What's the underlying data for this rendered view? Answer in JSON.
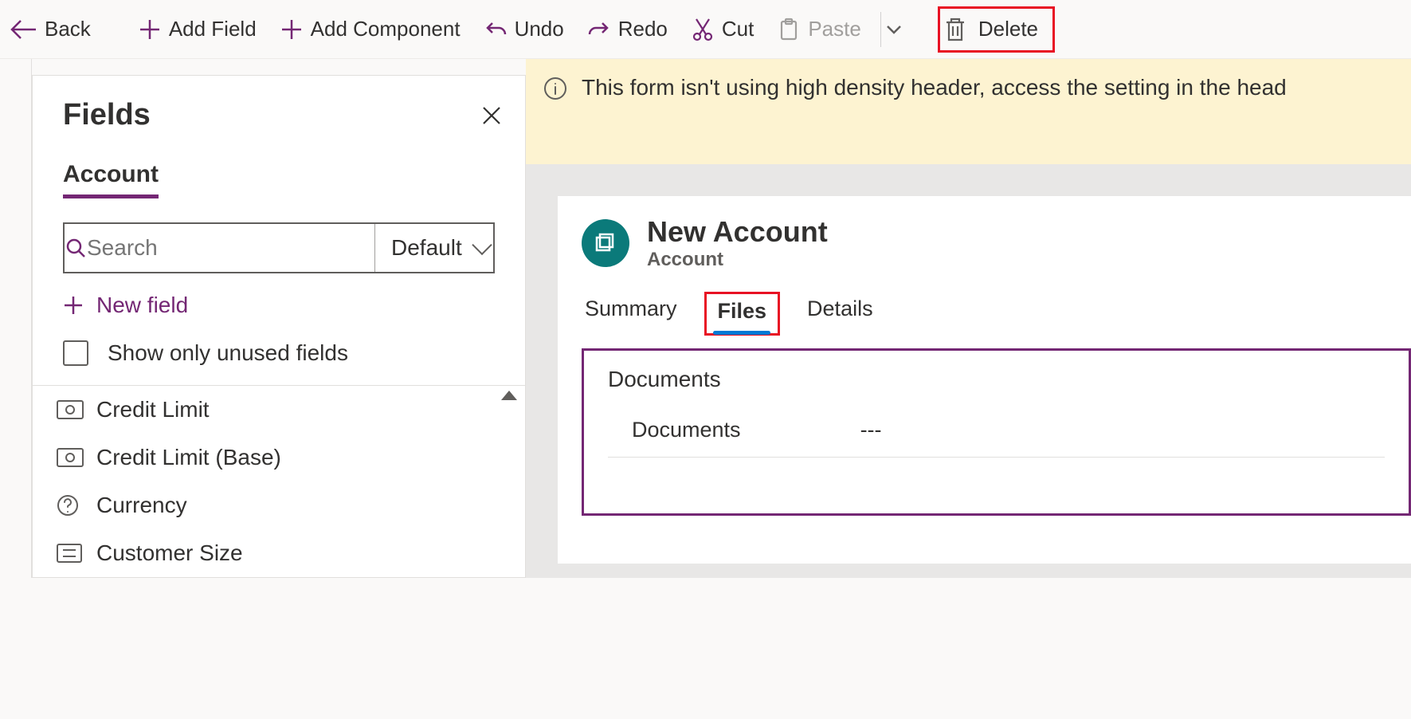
{
  "toolbar": {
    "back": "Back",
    "add_field": "Add Field",
    "add_component": "Add Component",
    "undo": "Undo",
    "redo": "Redo",
    "cut": "Cut",
    "paste": "Paste",
    "delete": "Delete"
  },
  "panel": {
    "title": "Fields",
    "tab": "Account",
    "search_placeholder": "Search",
    "sort_default": "Default",
    "new_field": "New field",
    "show_unused": "Show only unused fields",
    "items": [
      {
        "label": "Credit Limit",
        "icon": "money"
      },
      {
        "label": "Credit Limit (Base)",
        "icon": "money"
      },
      {
        "label": "Currency",
        "icon": "help"
      },
      {
        "label": "Customer Size",
        "icon": "options"
      }
    ]
  },
  "banner": "This form isn't using high density header, access the setting in the head",
  "form": {
    "title": "New Account",
    "subtitle": "Account",
    "tabs": [
      "Summary",
      "Files",
      "Details"
    ],
    "active_tab": "Files",
    "section_title": "Documents",
    "row_label": "Documents",
    "row_value": "---"
  }
}
